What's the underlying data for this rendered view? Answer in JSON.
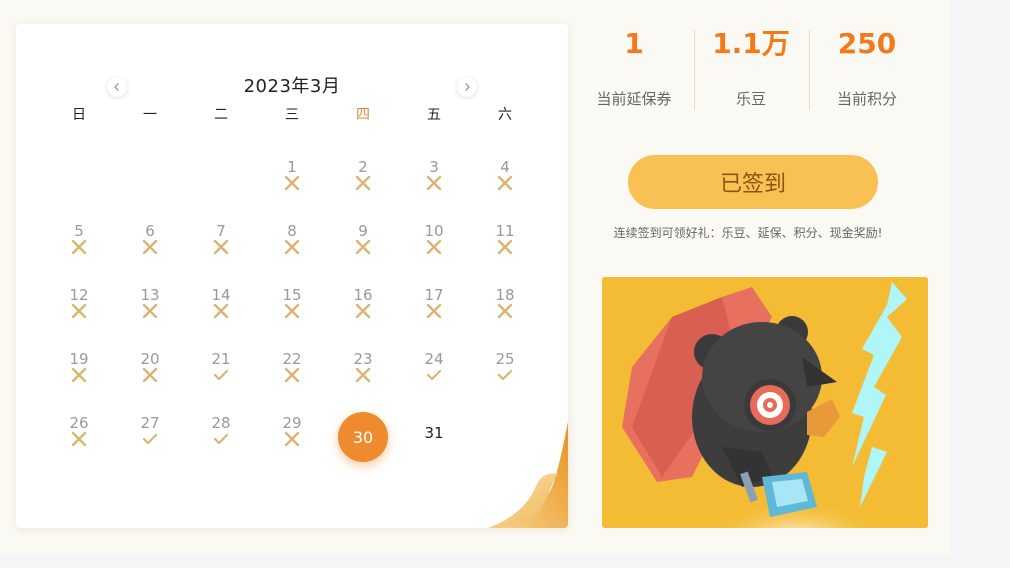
{
  "calendar": {
    "title": "2023年3月",
    "weekdays": [
      "日",
      "一",
      "二",
      "三",
      "四",
      "五",
      "六"
    ],
    "highlight_weekday_index": 4,
    "today": "30",
    "days": [
      {
        "n": "1",
        "s": "missed"
      },
      {
        "n": "2",
        "s": "missed"
      },
      {
        "n": "3",
        "s": "missed"
      },
      {
        "n": "4",
        "s": "missed"
      },
      {
        "n": "5",
        "s": "missed"
      },
      {
        "n": "6",
        "s": "missed"
      },
      {
        "n": "7",
        "s": "missed"
      },
      {
        "n": "8",
        "s": "missed"
      },
      {
        "n": "9",
        "s": "missed"
      },
      {
        "n": "10",
        "s": "missed"
      },
      {
        "n": "11",
        "s": "missed"
      },
      {
        "n": "12",
        "s": "missed"
      },
      {
        "n": "13",
        "s": "missed"
      },
      {
        "n": "14",
        "s": "missed"
      },
      {
        "n": "15",
        "s": "missed"
      },
      {
        "n": "16",
        "s": "missed"
      },
      {
        "n": "17",
        "s": "missed"
      },
      {
        "n": "18",
        "s": "missed"
      },
      {
        "n": "19",
        "s": "missed"
      },
      {
        "n": "20",
        "s": "missed"
      },
      {
        "n": "21",
        "s": "signed"
      },
      {
        "n": "22",
        "s": "missed"
      },
      {
        "n": "23",
        "s": "missed"
      },
      {
        "n": "24",
        "s": "signed"
      },
      {
        "n": "25",
        "s": "signed"
      },
      {
        "n": "26",
        "s": "missed"
      },
      {
        "n": "27",
        "s": "signed"
      },
      {
        "n": "28",
        "s": "signed"
      },
      {
        "n": "29",
        "s": "missed"
      },
      {
        "n": "30",
        "s": "today"
      },
      {
        "n": "31",
        "s": "future"
      }
    ],
    "first_weekday_index": 3
  },
  "stats": [
    {
      "value": "1",
      "label": "当前延保券"
    },
    {
      "value": "1.1万",
      "label": "乐豆"
    },
    {
      "value": "250",
      "label": "当前积分"
    }
  ],
  "sign_button_label": "已签到",
  "reward_text": "连续签到可领好礼：乐豆、延保、积分、现金奖励!",
  "colors": {
    "accent": "#f27a1a",
    "today": "#ef8b2e",
    "button": "#f9c154",
    "mark": "#d9b472",
    "promo_bg": "#f4bc34"
  },
  "icons": {
    "prev": "chevron-left-icon",
    "next": "chevron-right-icon",
    "missed": "cross-icon",
    "signed": "check-icon"
  }
}
